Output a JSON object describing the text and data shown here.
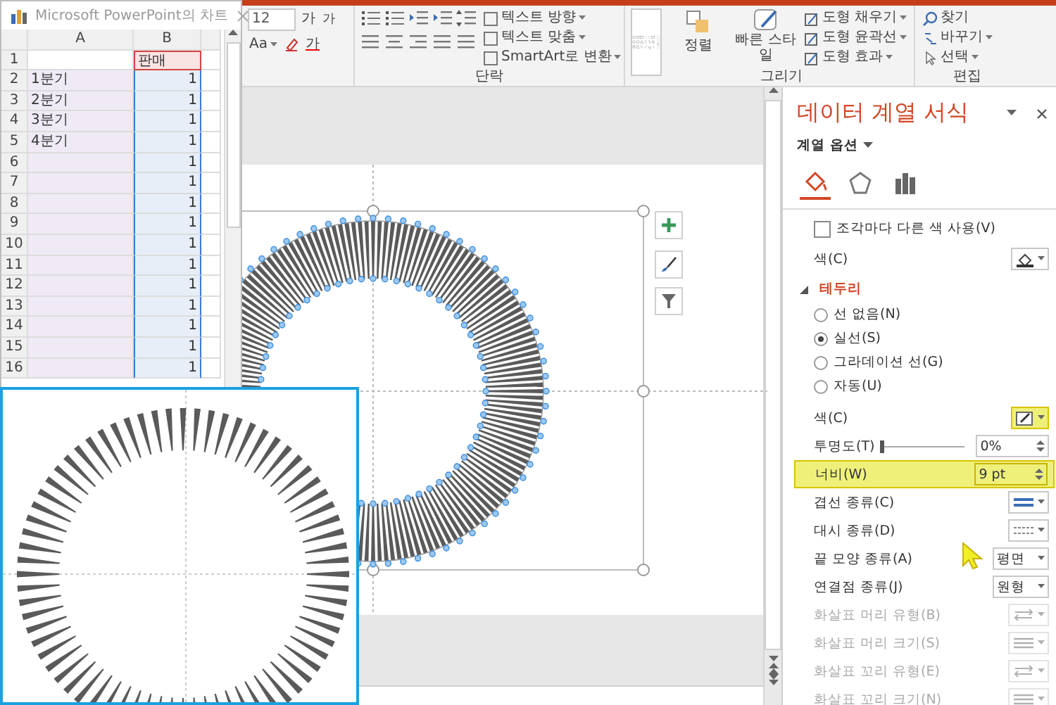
{
  "ribbon": {
    "font": {
      "size": "12",
      "buttons": [
        "가",
        "가",
        "Aa",
        "가"
      ]
    },
    "paragraph": {
      "label": "단락",
      "commands": [
        "텍스트 방향",
        "텍스트 맞춤",
        "SmartArt로 변환"
      ]
    },
    "drawing": {
      "label": "그리기",
      "arrange": "정렬",
      "quick_styles": "빠른 스타일",
      "commands": [
        "도형 채우기",
        "도형 윤곽선",
        "도형 효과"
      ]
    },
    "editing": {
      "label": "편집",
      "commands": [
        "찾기",
        "바꾸기",
        "선택"
      ]
    }
  },
  "spreadsheet": {
    "title": "Microsoft PowerPoint의 차트",
    "columns": [
      "A",
      "B"
    ],
    "rows": [
      {
        "label": "1",
        "b": "판매"
      },
      {
        "label": "2",
        "a": "1분기",
        "b": "1"
      },
      {
        "label": "3",
        "a": "2분기",
        "b": "1"
      },
      {
        "label": "4",
        "a": "3분기",
        "b": "1"
      },
      {
        "label": "5",
        "a": "4분기",
        "b": "1"
      },
      {
        "label": "6",
        "b": "1"
      },
      {
        "label": "7",
        "b": "1"
      },
      {
        "label": "8",
        "b": "1"
      },
      {
        "label": "9",
        "b": "1"
      },
      {
        "label": "10",
        "b": "1"
      },
      {
        "label": "11",
        "b": "1"
      },
      {
        "label": "12",
        "b": "1"
      },
      {
        "label": "13",
        "b": "1"
      },
      {
        "label": "14",
        "b": "1"
      },
      {
        "label": "15",
        "b": "1"
      },
      {
        "label": "16",
        "b": "1"
      }
    ]
  },
  "pane": {
    "title": "데이터 계열 서식",
    "section": "계열 옵션",
    "tabs": [
      {
        "kind": "fill",
        "selected": true
      },
      {
        "kind": "effects",
        "selected": false
      },
      {
        "kind": "series",
        "selected": false
      }
    ],
    "vary_colors": {
      "label": "조각마다 다른 색 사용(V)",
      "checked": false
    },
    "fill_color": {
      "label": "색(C)"
    },
    "border": {
      "label": "테두리",
      "expanded": true,
      "line_options": [
        {
          "label": "선 없음(N)",
          "selected": false
        },
        {
          "label": "실선(S)",
          "selected": true
        },
        {
          "label": "그라데이션 선(G)",
          "selected": false
        },
        {
          "label": "자동(U)",
          "selected": false
        }
      ]
    },
    "properties": [
      {
        "kind": "color",
        "label": "색(C)",
        "highlighted": true,
        "disabled": false
      },
      {
        "kind": "slider",
        "label": "투명도(T)",
        "level": 0,
        "value": "0%",
        "highlighted": false,
        "disabled": false
      },
      {
        "kind": "spin",
        "label": "너비(W)",
        "value": "9 pt",
        "highlighted": true,
        "disabled": false
      },
      {
        "kind": "compound",
        "label": "겹선 종류(C)",
        "highlighted": false,
        "disabled": false
      },
      {
        "kind": "dash",
        "label": "대시 종류(D)",
        "highlighted": false,
        "disabled": false
      },
      {
        "kind": "select",
        "label": "끝 모양 종류(A)",
        "value": "평면",
        "highlighted": false,
        "disabled": false
      },
      {
        "kind": "select",
        "label": "연결점 종류(J)",
        "value": "원형",
        "highlighted": false,
        "disabled": false
      },
      {
        "kind": "arrow-type",
        "label": "화살표 머리 유형(B)",
        "highlighted": false,
        "disabled": true
      },
      {
        "kind": "arrow-size",
        "label": "화살표 머리 크기(S)",
        "highlighted": false,
        "disabled": true
      },
      {
        "kind": "arrow-type",
        "label": "화살표 꼬리 유형(E)",
        "highlighted": false,
        "disabled": true
      },
      {
        "kind": "arrow-size",
        "label": "화살표 꼬리 크기(N)",
        "highlighted": false,
        "disabled": true
      }
    ]
  }
}
